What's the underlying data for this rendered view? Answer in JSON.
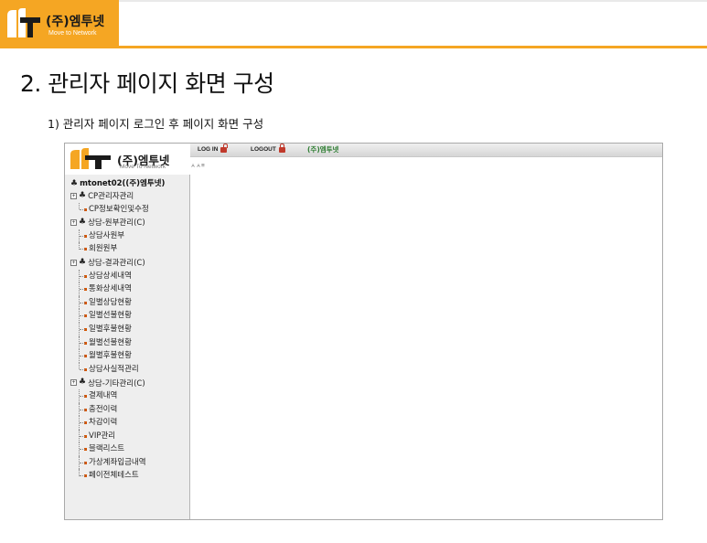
{
  "banner": {
    "company_name": "(주)엠투넷",
    "company_sub": "Move to Network",
    "accent_color": "#f5a623"
  },
  "heading": "2. 관리자 페이지 화면 구성",
  "subheading": "1) 관리자 페이지 로그인 후 페이지 화면 구성",
  "screenshot": {
    "logo_name": "(주)엠투넷",
    "logo_sub": "Move To Network",
    "topbar": {
      "login_label": "LOG IN",
      "logout_label": "LOGOUT",
      "brand_label": "(주)엠투넷"
    },
    "font_size_control": "ㅅㅅ≡",
    "tree": {
      "root": "mtonet02((주)엠투넷)",
      "groups": [
        {
          "label": "CP관리자관리",
          "items": [
            "CP정보확인및수정"
          ]
        },
        {
          "label": "상담-원부관리(C)",
          "items": [
            "상담사원부",
            "회원원부"
          ]
        },
        {
          "label": "상담-결과관리(C)",
          "items": [
            "상담상세내역",
            "통화상세내역",
            "일별상담현황",
            "일별선불현황",
            "일별후불현황",
            "월별선불현황",
            "월별후불현황",
            "상담사실적관리"
          ]
        },
        {
          "label": "상담-기타관리(C)",
          "items": [
            "결제내역",
            "충전이력",
            "차감이력",
            "VIP관리",
            "블랙리스트",
            "가상계좌입금내역",
            "페이전체테스트"
          ]
        }
      ]
    }
  }
}
